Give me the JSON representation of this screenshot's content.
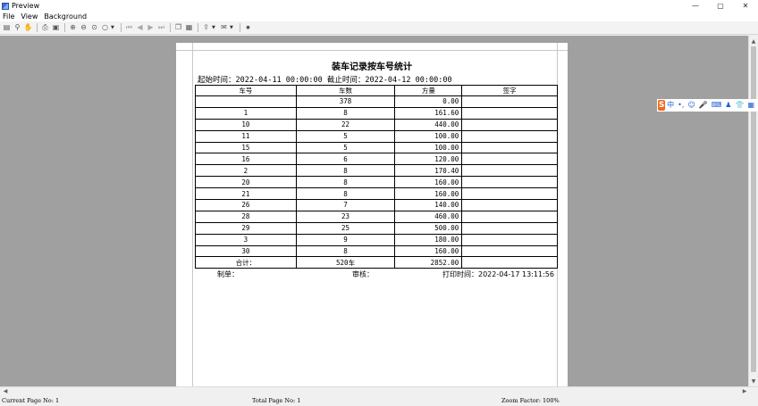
{
  "window": {
    "title": "Preview",
    "controls": {
      "minimize": "—",
      "maximize": "▢",
      "close": "✕"
    }
  },
  "menu": [
    "File",
    "View",
    "Background"
  ],
  "toolbar": {
    "icons": [
      "page-setup-icon",
      "find-icon",
      "hand-icon",
      "print-icon",
      "print-setup-icon",
      "zoom-in-icon",
      "zoom-out-icon",
      "zoom-width-icon",
      "zoom-icon",
      "first-page-icon",
      "prev-page-icon",
      "next-page-icon",
      "last-page-icon",
      "copy-icon",
      "properties-icon",
      "export-icon",
      "email-icon",
      "stop-icon"
    ]
  },
  "report": {
    "title": "装车记录按车号统计",
    "range": "起始时间：2022-04-11 00:00:00 截止时间：2022-04-12 00:00:00",
    "columns": [
      "车号",
      "车数",
      "方量",
      "签字"
    ],
    "rows": [
      [
        "",
        "378",
        "0.00",
        ""
      ],
      [
        "1",
        "8",
        "161.60",
        ""
      ],
      [
        "10",
        "22",
        "440.00",
        ""
      ],
      [
        "11",
        "5",
        "100.00",
        ""
      ],
      [
        "15",
        "5",
        "100.00",
        ""
      ],
      [
        "16",
        "6",
        "120.00",
        ""
      ],
      [
        "2",
        "8",
        "170.40",
        ""
      ],
      [
        "20",
        "8",
        "160.00",
        ""
      ],
      [
        "21",
        "8",
        "160.00",
        ""
      ],
      [
        "26",
        "7",
        "140.00",
        ""
      ],
      [
        "28",
        "23",
        "460.00",
        ""
      ],
      [
        "29",
        "25",
        "500.00",
        ""
      ],
      [
        "3",
        "9",
        "180.00",
        ""
      ],
      [
        "30",
        "8",
        "160.00",
        ""
      ]
    ],
    "total": [
      "合计：",
      "520车",
      "2852.00",
      ""
    ],
    "footer": {
      "maker": "制单：",
      "reviewer": "审核：",
      "print_time": "打印时间：2022-04-17 13:11:56"
    }
  },
  "ime": {
    "logo": "S",
    "items": [
      "中",
      "•,",
      "☺",
      "🎤",
      "⌨",
      "♟",
      "👕",
      "▦"
    ]
  },
  "status": {
    "current_page": "Current Page No: 1",
    "total_page": "Total Page No: 1",
    "zoom": "Zoom Factor: 100%"
  }
}
